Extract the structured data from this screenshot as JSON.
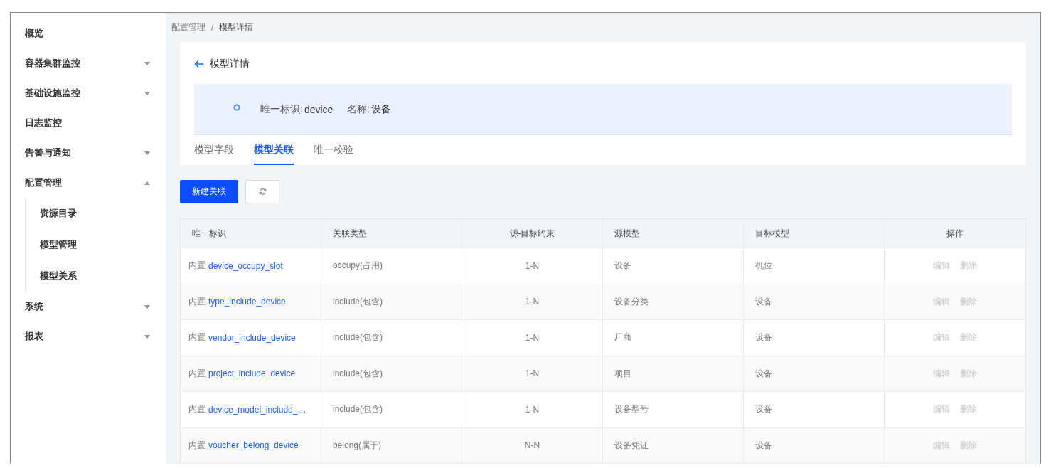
{
  "sidebar": {
    "items": [
      {
        "label": "概览",
        "kind": "link"
      },
      {
        "label": "容器集群监控",
        "kind": "group",
        "expanded": false
      },
      {
        "label": "基础设施监控",
        "kind": "group",
        "expanded": false
      },
      {
        "label": "日志监控",
        "kind": "link"
      },
      {
        "label": "告警与通知",
        "kind": "group",
        "expanded": false
      },
      {
        "label": "配置管理",
        "kind": "group",
        "expanded": true,
        "children": [
          {
            "label": "资源目录"
          },
          {
            "label": "模型管理"
          },
          {
            "label": "模型关系"
          }
        ]
      },
      {
        "label": "系统",
        "kind": "group",
        "expanded": false
      },
      {
        "label": "报表",
        "kind": "group",
        "expanded": false
      }
    ]
  },
  "breadcrumb": [
    "配置管理",
    "/",
    "模型详情"
  ],
  "header": {
    "title": "模型详情",
    "id_label": "唯一标识:",
    "id_value": "device",
    "name_label": "名称:",
    "name_value": "设备"
  },
  "tabs": [
    {
      "label": "模型字段",
      "selected": false
    },
    {
      "label": "模型关联",
      "selected": true
    },
    {
      "label": "唯一校验",
      "selected": false
    }
  ],
  "toolbar": {
    "create_button": "新建关联"
  },
  "table": {
    "columns": [
      "唯一标识",
      "关联类型",
      "源-目标约束",
      "源模型",
      "目标模型",
      "操作"
    ],
    "rows": [
      {
        "tag": "内置",
        "id": "device_occupy_slot",
        "type": "occupy(占用)",
        "constraint": "1-N",
        "source": "设备",
        "target": "机位",
        "actions": [
          {
            "label": "编辑",
            "disabled": true
          },
          {
            "label": "删除",
            "disabled": true
          }
        ]
      },
      {
        "tag": "内置",
        "id": "type_include_device",
        "type": "include(包含)",
        "constraint": "1-N",
        "source": "设备分类",
        "target": "设备",
        "actions": [
          {
            "label": "编辑",
            "disabled": true
          },
          {
            "label": "删除",
            "disabled": true
          }
        ]
      },
      {
        "tag": "内置",
        "id": "vendor_include_device",
        "type": "include(包含)",
        "constraint": "1-N",
        "source": "厂商",
        "target": "设备",
        "actions": [
          {
            "label": "编辑",
            "disabled": true
          },
          {
            "label": "删除",
            "disabled": true
          }
        ]
      },
      {
        "tag": "内置",
        "id": "project_include_device",
        "type": "include(包含)",
        "constraint": "1-N",
        "source": "项目",
        "target": "设备",
        "actions": [
          {
            "label": "编辑",
            "disabled": true
          },
          {
            "label": "删除",
            "disabled": true
          }
        ]
      },
      {
        "tag": "内置",
        "id": "device_model_include_…",
        "type": "include(包含)",
        "constraint": "1-N",
        "source": "设备型号",
        "target": "设备",
        "actions": [
          {
            "label": "编辑",
            "disabled": true
          },
          {
            "label": "删除",
            "disabled": true
          }
        ]
      },
      {
        "tag": "内置",
        "id": "voucher_belong_device",
        "type": "belong(属于)",
        "constraint": "N-N",
        "source": "设备凭证",
        "target": "设备",
        "actions": [
          {
            "label": "编辑",
            "disabled": true
          },
          {
            "label": "删除",
            "disabled": true
          }
        ]
      }
    ]
  }
}
